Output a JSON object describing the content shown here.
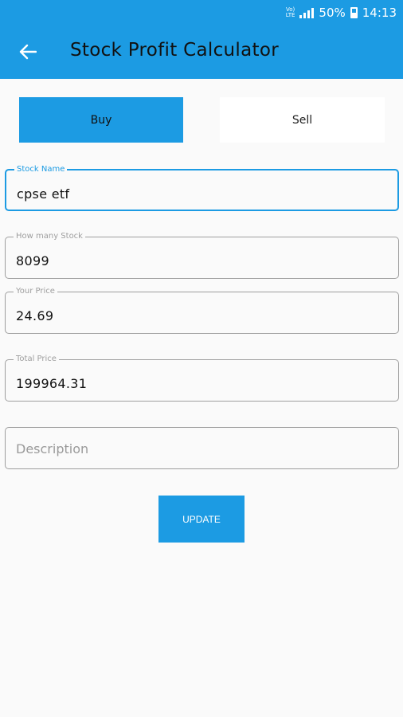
{
  "status_bar": {
    "network": "Vo) LTE",
    "battery_percent": "50%",
    "time": "14:13"
  },
  "app_bar": {
    "title": "Stock Profit Calculator",
    "back_icon": "arrow-left-icon"
  },
  "tabs": [
    {
      "label": "Buy",
      "selected": true
    },
    {
      "label": "Sell",
      "selected": false
    }
  ],
  "form": {
    "stock_name": {
      "label": "Stock Name",
      "value": "cpse etf"
    },
    "quantity": {
      "label": "How many Stock",
      "value": "8099"
    },
    "price": {
      "label": "Your Price",
      "value": "24.69"
    },
    "total": {
      "label": "Total Price",
      "value": "199964.31"
    },
    "description": {
      "placeholder": "Description"
    }
  },
  "actions": {
    "update_label": "UPDATE"
  },
  "colors": {
    "primary": "#1c9be3",
    "background": "#fafafa"
  }
}
